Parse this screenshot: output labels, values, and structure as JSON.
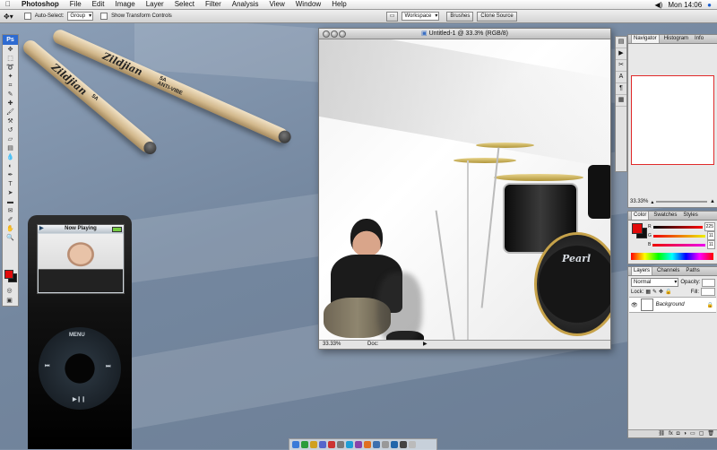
{
  "menubar": {
    "app": "Photoshop",
    "items": [
      "File",
      "Edit",
      "Image",
      "Layer",
      "Select",
      "Filter",
      "Analysis",
      "View",
      "Window",
      "Help"
    ],
    "clock": "Mon 14:06"
  },
  "options": {
    "auto_select": "Auto-Select:",
    "group_value": "Group",
    "show_transform": "Show Transform Controls",
    "workspace": "Workspace",
    "brushes_tab": "Brushes",
    "clone_tab": "Clone Source"
  },
  "tools": {
    "logo": "Ps"
  },
  "drumsticks": {
    "brand": "Zildjian",
    "model": "5A",
    "tag": "ANTI-VIBE"
  },
  "ipod": {
    "screen_title": "Now Playing",
    "menu": "MENU",
    "prev": "⏮",
    "next": "⏭",
    "playpause": "▶❙❙"
  },
  "document": {
    "title": "Untitled-1 @ 33.3% (RGB/8)",
    "zoom": "33.33%",
    "doc_label": "Doc:",
    "drum_brand": "Pearl"
  },
  "panels": {
    "navigator": {
      "tabs": [
        "Navigator",
        "Histogram",
        "Info"
      ],
      "zoom": "33.33%"
    },
    "color": {
      "tabs": [
        "Color",
        "Swatches",
        "Styles"
      ],
      "r_label": "R",
      "r_value": "225",
      "g_label": "G",
      "g_value": "11",
      "b_label": "B",
      "b_value": "11"
    },
    "layers": {
      "tabs": [
        "Layers",
        "Channels",
        "Paths"
      ],
      "blend": "Normal",
      "opacity_label": "Opacity:",
      "lock_label": "Lock:",
      "fill_label": "Fill:",
      "layer_name": "Background"
    }
  },
  "colors": {
    "accent": "#e20b0b",
    "ps_blue": "#2e6bd1"
  }
}
